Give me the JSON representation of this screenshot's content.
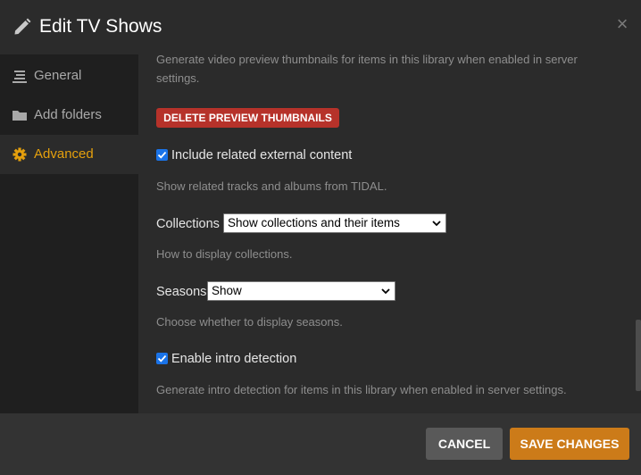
{
  "dialog": {
    "title": "Edit TV Shows",
    "title_icon": "pencil-icon",
    "close_glyph": "×"
  },
  "sidebar": {
    "items": [
      {
        "label": "General",
        "icon": "list-icon",
        "active": false
      },
      {
        "label": "Add folders",
        "icon": "folder-icon",
        "active": false
      },
      {
        "label": "Advanced",
        "icon": "gear-icon",
        "active": true
      }
    ]
  },
  "content": {
    "preview_help": "Generate video preview thumbnails for items in this library when enabled in server settings.",
    "delete_previews_label": "DELETE PREVIEW THUMBNAILS",
    "related_content": {
      "label": "Include related external content",
      "checked": true,
      "help": "Show related tracks and albums from TIDAL."
    },
    "collections": {
      "label": "Collections",
      "value": "Show collections and their items",
      "help": "How to display collections."
    },
    "seasons": {
      "label": "Seasons",
      "value": "Show",
      "help": "Choose whether to display seasons."
    },
    "intro_detection": {
      "label": "Enable intro detection",
      "checked": true,
      "help": "Generate intro detection for items in this library when enabled in server settings."
    }
  },
  "footer": {
    "cancel_label": "CANCEL",
    "save_label": "SAVE CHANGES"
  },
  "colors": {
    "accent": "#e5a00d",
    "danger": "#b6322a",
    "save": "#cc7b19",
    "checkbox": "#1a73e8"
  }
}
